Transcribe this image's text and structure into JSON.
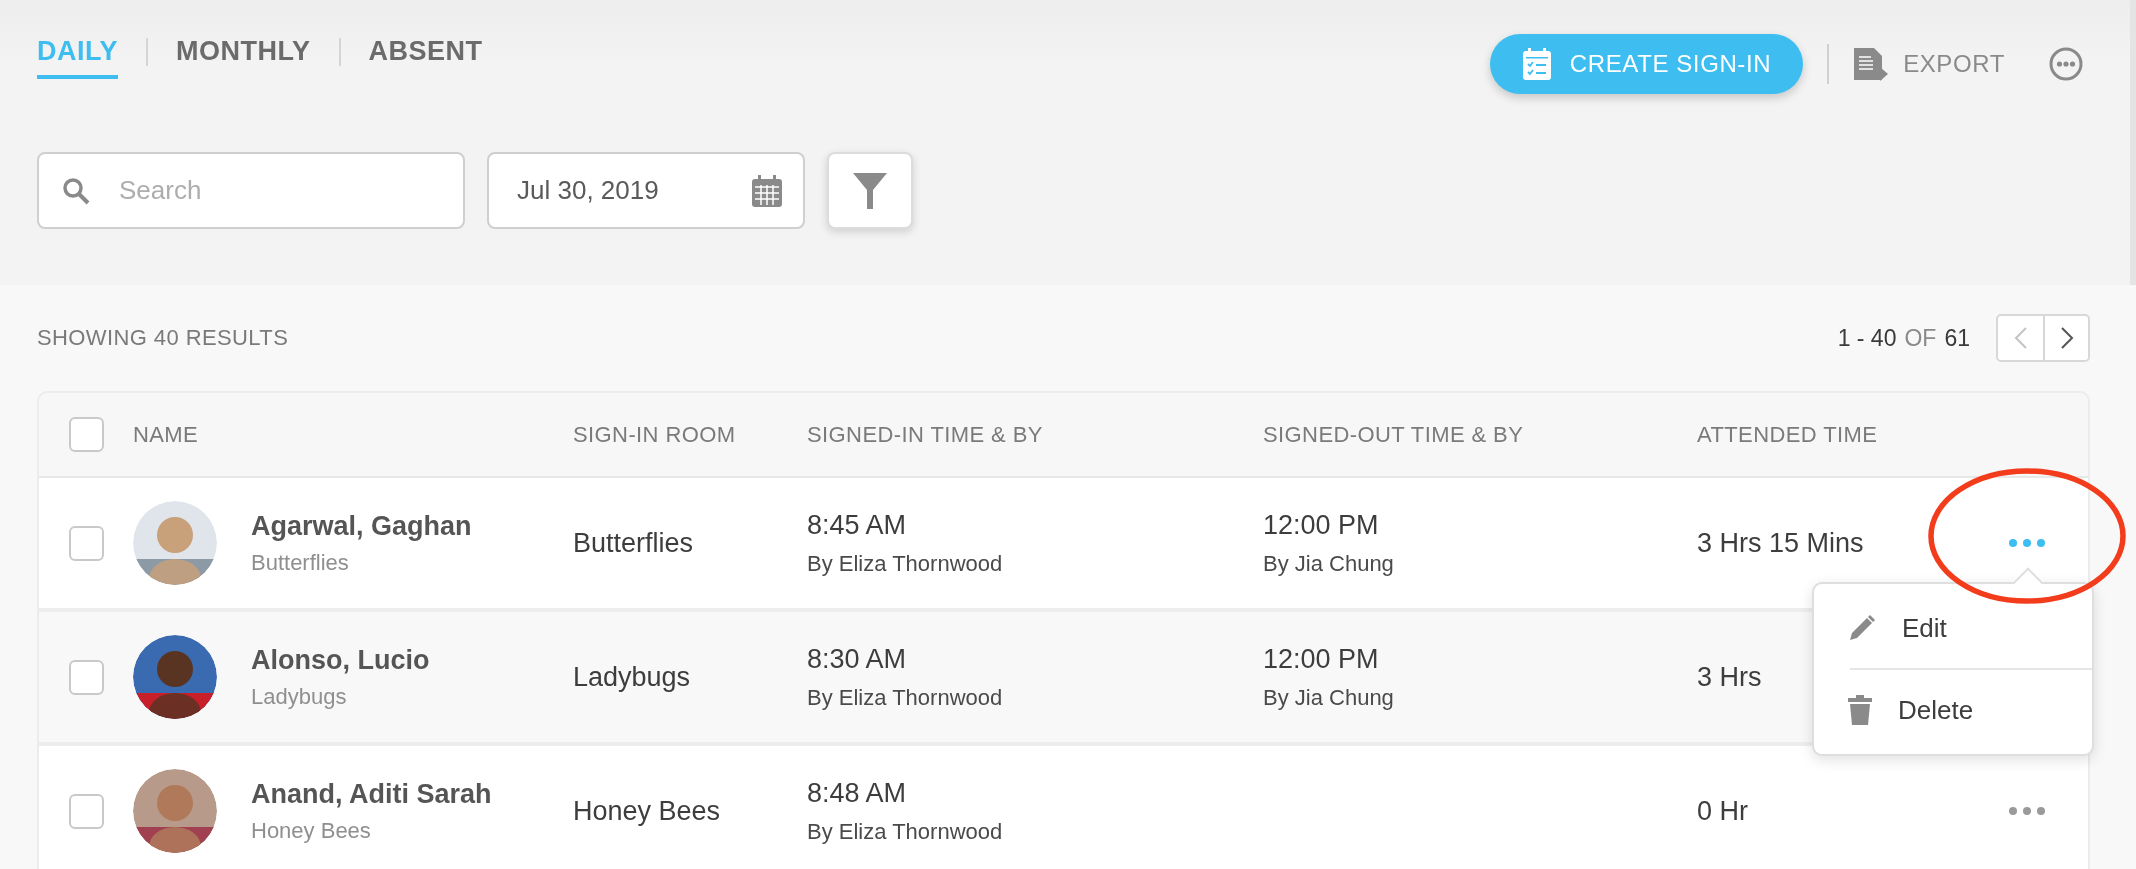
{
  "tabs": [
    {
      "label": "DAILY",
      "selected": true
    },
    {
      "label": "MONTHLY",
      "selected": false
    },
    {
      "label": "ABSENT",
      "selected": false
    }
  ],
  "actions": {
    "create": "CREATE SIGN-IN",
    "export": "EXPORT"
  },
  "search": {
    "placeholder": "Search"
  },
  "date": {
    "value": "Jul 30, 2019"
  },
  "results": {
    "summary": "SHOWING 40 RESULTS",
    "range": "1 - 40",
    "of": "OF",
    "total": "61"
  },
  "table": {
    "columns": [
      "NAME",
      "SIGN-IN ROOM",
      "SIGNED-IN TIME & BY",
      "SIGNED-OUT TIME & BY",
      "ATTENDED TIME"
    ],
    "select_all": false,
    "rows": [
      {
        "name": "Agarwal, Gaghan",
        "group": "Butterflies",
        "room": "Butterflies",
        "in_time": "8:45 AM",
        "in_by": "By Eliza Thornwood",
        "out_time": "12:00 PM",
        "out_by": "By Jia Chung",
        "attended": "3 Hrs 15 Mins",
        "checked": false,
        "menu_open": true
      },
      {
        "name": "Alonso, Lucio",
        "group": "Ladybugs",
        "room": "Ladybugs",
        "in_time": "8:30 AM",
        "in_by": "By Eliza Thornwood",
        "out_time": "12:00 PM",
        "out_by": "By Jia Chung",
        "attended": "3 Hrs",
        "checked": false
      },
      {
        "name": "Anand, Aditi Sarah",
        "group": "Honey Bees",
        "room": "Honey Bees",
        "in_time": "8:48 AM",
        "in_by": "By Eliza Thornwood",
        "attended": "0 Hr",
        "checked": false,
        "menu_open": false
      }
    ]
  },
  "row_menu": [
    {
      "kind": "edit",
      "label": "Edit"
    },
    {
      "kind": "delete",
      "label": "Delete"
    }
  ]
}
